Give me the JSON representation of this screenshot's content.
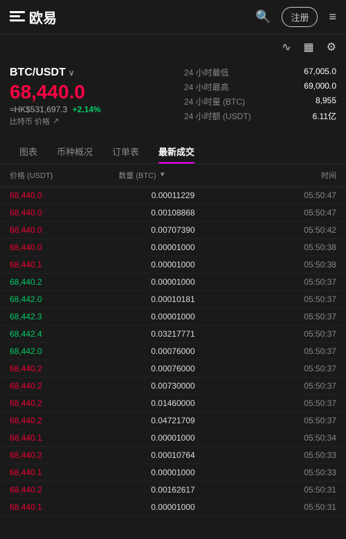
{
  "header": {
    "logo_text": "欧易",
    "register_label": "注册",
    "menu_icon": "≡"
  },
  "subheader": {
    "chart_icon": "∿",
    "grid_icon": "▦",
    "gear_icon": "⚙"
  },
  "market": {
    "pair": "BTC/USDT",
    "price": "68,440.0",
    "price_hk": "≈HK$531,697.3",
    "price_change": "+2.14%",
    "price_label": "比特币 价格",
    "stats": [
      {
        "label": "24 小时最低",
        "value": "67,005.0"
      },
      {
        "label": "24 小时最高",
        "value": "69,000.0"
      },
      {
        "label": "24 小时量 (BTC)",
        "value": "8,955"
      },
      {
        "label": "24 小时额 (USDT)",
        "value": "6.11亿"
      }
    ]
  },
  "tabs": [
    {
      "id": "chart",
      "label": "图表"
    },
    {
      "id": "overview",
      "label": "币种概况"
    },
    {
      "id": "orders",
      "label": "订单表"
    },
    {
      "id": "trades",
      "label": "最新成交",
      "active": true
    }
  ],
  "trades_header": {
    "price_col": "价格 (USDT)",
    "qty_col": "数量 (BTC)",
    "time_col": "时间"
  },
  "trades": [
    {
      "price": "68,440.0",
      "type": "red",
      "qty": "0.00011229",
      "time": "05:50:47"
    },
    {
      "price": "68,440.0",
      "type": "red",
      "qty": "0.00108868",
      "time": "05:50:47"
    },
    {
      "price": "68,440.0",
      "type": "red",
      "qty": "0.00707390",
      "time": "05:50:42"
    },
    {
      "price": "68,440.0",
      "type": "red",
      "qty": "0.00001000",
      "time": "05:50:38"
    },
    {
      "price": "68,440.1",
      "type": "red",
      "qty": "0.00001000",
      "time": "05:50:38"
    },
    {
      "price": "68,440.2",
      "type": "green",
      "qty": "0.00001000",
      "time": "05:50:37"
    },
    {
      "price": "68,442.0",
      "type": "green",
      "qty": "0.00010181",
      "time": "05:50:37"
    },
    {
      "price": "68,442.3",
      "type": "green",
      "qty": "0.00001000",
      "time": "05:50:37"
    },
    {
      "price": "68,442.4",
      "type": "green",
      "qty": "0.03217771",
      "time": "05:50:37"
    },
    {
      "price": "68,442.0",
      "type": "green",
      "qty": "0.00076000",
      "time": "05:50:37"
    },
    {
      "price": "68,440.2",
      "type": "red",
      "qty": "0.00076000",
      "time": "05:50:37"
    },
    {
      "price": "68,440.2",
      "type": "red",
      "qty": "0.00730000",
      "time": "05:50:37"
    },
    {
      "price": "68,440.2",
      "type": "red",
      "qty": "0.01460000",
      "time": "05:50:37"
    },
    {
      "price": "68,440.2",
      "type": "red",
      "qty": "0.04721709",
      "time": "05:50:37"
    },
    {
      "price": "68,440.1",
      "type": "red",
      "qty": "0.00001000",
      "time": "05:50:34"
    },
    {
      "price": "68,440.2",
      "type": "red",
      "qty": "0.00010764",
      "time": "05:50:33"
    },
    {
      "price": "68,440.1",
      "type": "red",
      "qty": "0.00001000",
      "time": "05:50:33"
    },
    {
      "price": "68,440.2",
      "type": "red",
      "qty": "0.00162617",
      "time": "05:50:31"
    },
    {
      "price": "68,440.1",
      "type": "red",
      "qty": "0.00001000",
      "time": "05:50:31"
    }
  ]
}
